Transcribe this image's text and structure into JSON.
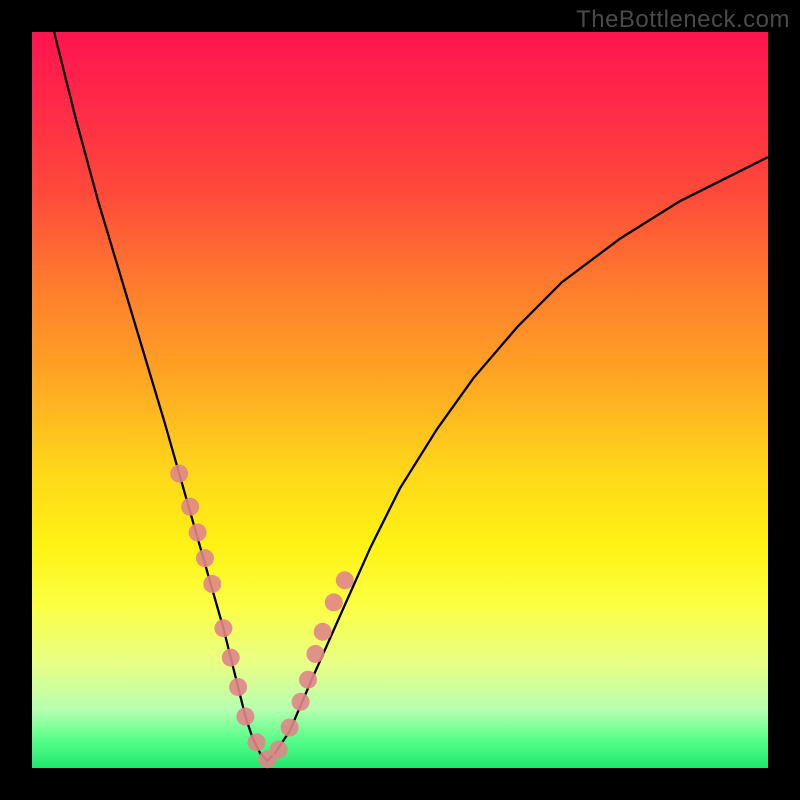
{
  "watermark": "TheBottleneck.com",
  "chart_data": {
    "type": "line",
    "title": "",
    "xlabel": "",
    "ylabel": "",
    "xlim": [
      0,
      100
    ],
    "ylim": [
      0,
      100
    ],
    "series": [
      {
        "name": "bottleneck-curve",
        "x": [
          3,
          6,
          9,
          12,
          15,
          18,
          20,
          22,
          24,
          26,
          27,
          28,
          29,
          30,
          31,
          32,
          33,
          35,
          38,
          42,
          46,
          50,
          55,
          60,
          66,
          72,
          80,
          88,
          96,
          100
        ],
        "y": [
          100,
          88,
          77,
          67,
          57,
          47,
          40,
          33,
          26,
          19,
          15,
          11,
          7,
          4,
          2,
          1,
          2,
          5,
          12,
          21,
          30,
          38,
          46,
          53,
          60,
          66,
          72,
          77,
          81,
          83
        ]
      }
    ],
    "markers": {
      "name": "highlight-dots",
      "x": [
        20,
        21.5,
        22.5,
        23.5,
        24.5,
        26,
        27,
        28,
        29,
        30.5,
        32,
        33.5,
        35,
        36.5,
        37.5,
        38.5,
        39.5,
        41,
        42.5
      ],
      "y": [
        40,
        35.5,
        32,
        28.5,
        25,
        19,
        15,
        11,
        7,
        3.5,
        1.2,
        2.5,
        5.5,
        9,
        12,
        15.5,
        18.5,
        22.5,
        25.5
      ]
    },
    "background_gradient": {
      "stops": [
        {
          "pos": 0.0,
          "color": "#ff1450"
        },
        {
          "pos": 0.22,
          "color": "#ff4a3a"
        },
        {
          "pos": 0.46,
          "color": "#ffa224"
        },
        {
          "pos": 0.7,
          "color": "#fff314"
        },
        {
          "pos": 0.86,
          "color": "#e7ff86"
        },
        {
          "pos": 1.0,
          "color": "#1fe86e"
        }
      ]
    },
    "marker_color": "#e08688",
    "curve_color": "#000000"
  }
}
